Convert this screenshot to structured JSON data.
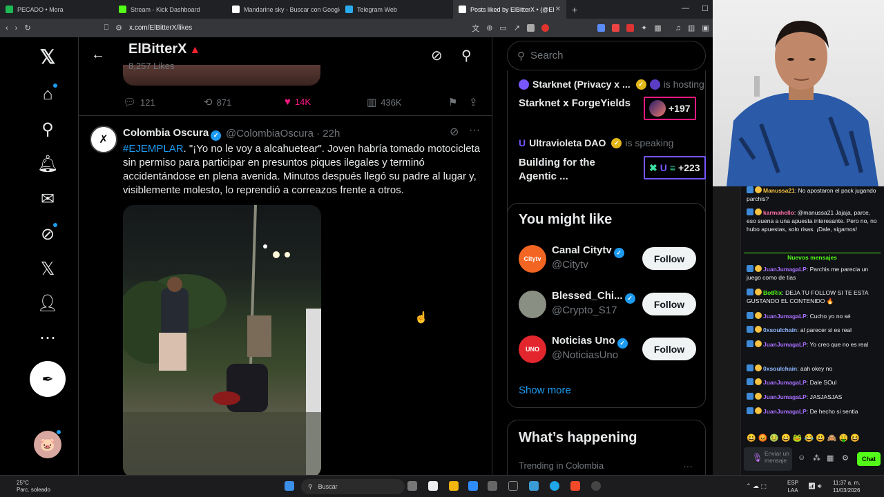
{
  "browser": {
    "tabs": [
      {
        "title": "PECADO • Mora",
        "color": "#1db954",
        "active": false
      },
      {
        "title": "Stream - Kick Dashboard",
        "color": "#53fc18",
        "active": false
      },
      {
        "title": "Mandarine sky - Buscar con Google",
        "color": "#ffffff",
        "active": false
      },
      {
        "title": "Telegram Web",
        "color": "#2aabee",
        "active": false
      },
      {
        "title": "Posts liked by ElBitterX • (@El",
        "color": "#ffffff",
        "active": true
      }
    ],
    "new_tab": "+",
    "url": "x.com/ElBitterX/likes"
  },
  "profile": {
    "name": "ElBitterX",
    "likes_count": "8,257 Likes"
  },
  "prev_post": {
    "replies": "121",
    "reposts": "871",
    "likes": "14K",
    "views": "436K"
  },
  "tweet": {
    "name": "Colombia Oscura",
    "handle": "@ColombiaOscura · 22h",
    "hashtag": "#EJEMPLAR",
    "text": ". \"¡Yo no le voy a alcahuetear\". Joven habría tomado motocicleta sin permiso para participar en presuntos piques ilegales y terminó accidentándose en plena avenida. Minutos después llegó su padre al lugar y, visiblemente molesto, lo reprendió a correazos frente a otros."
  },
  "sidebar": {
    "search_placeholder": "Search",
    "spaces": [
      {
        "host": "Starknet (Privacy x ...",
        "state": "is hosting",
        "title": "Starknet x ForgeYields",
        "count": "+197"
      },
      {
        "host": "Ultravioleta DAO",
        "state": "is speaking",
        "title": "Building for the Agentic ...",
        "count": "+223"
      }
    ],
    "who_to_follow": {
      "title": "You might like",
      "users": [
        {
          "name": "Canal Citytv",
          "handle": "@Citytv",
          "avatar_text": "Citytv",
          "avatar_color": "#f26522",
          "follow": "Follow"
        },
        {
          "name": "Blessed_Chi...",
          "handle": "@Crypto_S17",
          "avatar_text": "",
          "avatar_color": "#8a8f84",
          "follow": "Follow"
        },
        {
          "name": "Noticias Uno",
          "handle": "@NoticiasUno",
          "avatar_text": "UNO",
          "avatar_color": "#e3262d",
          "follow": "Follow"
        }
      ],
      "show_more": "Show more"
    },
    "happening": {
      "title": "What’s happening",
      "trend_context": "Trending in Colombia"
    }
  },
  "chat": {
    "messages_before": [
      {
        "user": "Manussa21",
        "user_color": "#f5c242",
        "text": "No apostaron el pack jugando parchis?"
      },
      {
        "user": "karmahello",
        "user_color": "#ff6fa8",
        "text": "@manussa21 Jajaja, parce, eso suena a una apuesta interesante. Pero no, no hubo apuestas, solo risas. ¡Dale, sigamos!"
      }
    ],
    "new_messages_label": "Nuevos mensajes",
    "messages_after": [
      {
        "user": "JuanJumagaLP",
        "user_color": "#a970ff",
        "text": "Parchis me parecia un juego como de tias"
      },
      {
        "user": "BotRix",
        "user_color": "#53fc18",
        "text": "DEJA TU FOLLOW SI TE ESTA GUSTANDO EL CONTENIDO 🔥"
      },
      {
        "user": "JuanJumagaLP",
        "user_color": "#a970ff",
        "text": "Cucho yo no sé"
      },
      {
        "user": "0xsoulchain",
        "user_color": "#8fb8ff",
        "text": "al parecer si es real"
      },
      {
        "user": "JuanJumagaLP",
        "user_color": "#a970ff",
        "text": "Yo creo que no es real"
      },
      {
        "user": "0xsoulchain",
        "user_color": "#8fb8ff",
        "text": "aah okey no"
      },
      {
        "user": "JuanJumagaLP",
        "user_color": "#a970ff",
        "text": "Dale SOul"
      },
      {
        "user": "JuanJumagaLP",
        "user_color": "#a970ff",
        "text": "JASJASJAS"
      },
      {
        "user": "JuanJumagaLP",
        "user_color": "#a970ff",
        "text": "De hecho si sentia"
      }
    ],
    "emotes": "😀😡🤢😄🐸😂😃🙈🤑😆",
    "input_placeholder": "Enviar un mensaje",
    "send_label": "Chat"
  },
  "taskbar": {
    "temp": "25°C",
    "weather": "Parc. soleado",
    "search": "Buscar",
    "lang_top": "ESP",
    "lang_bottom": "LAA",
    "time": "11:37 a. m.",
    "date": "11/03/2026"
  }
}
